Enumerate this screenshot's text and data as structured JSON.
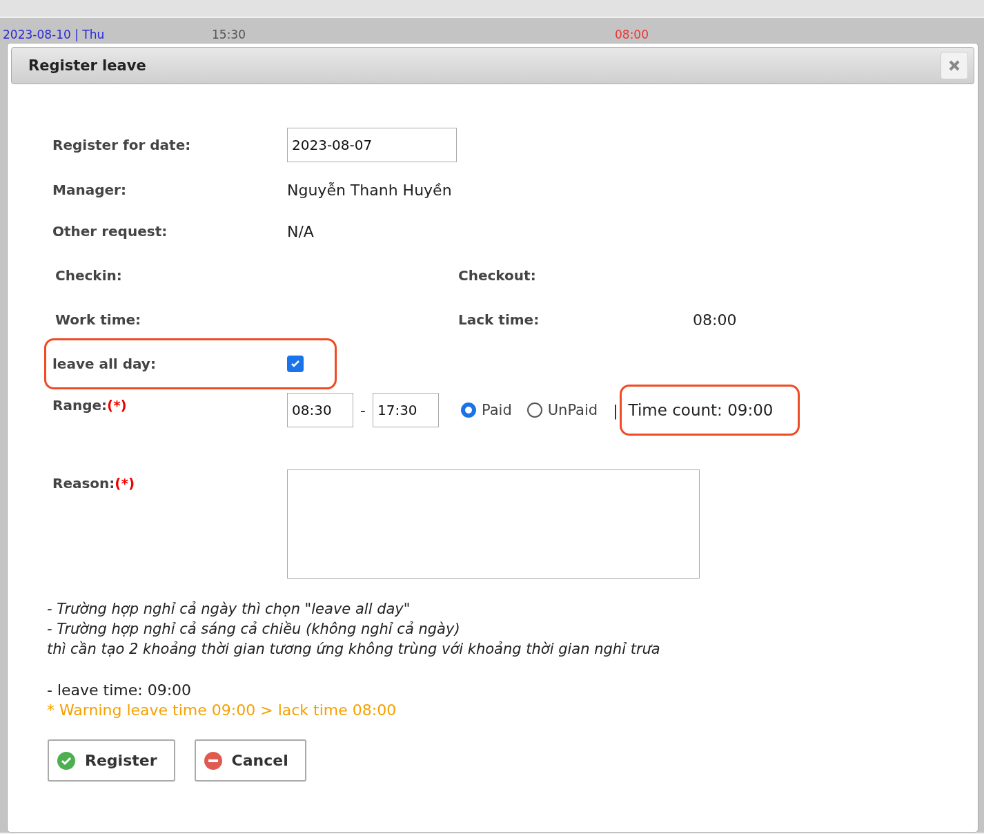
{
  "background_row": {
    "date": "2023-08-10 | Thu",
    "time": "15:30",
    "lack": "08:00"
  },
  "dialog": {
    "title": "Register leave"
  },
  "fields": [
    {
      "label": "Register for date:",
      "value": "2023-08-07",
      "kind": "input"
    },
    {
      "label": "Manager:",
      "value": "Nguyễn Thanh Huyền",
      "kind": "text"
    },
    {
      "label": "Other request:",
      "value": "N/A",
      "kind": "text"
    }
  ],
  "checkin": {
    "label": "Checkin:"
  },
  "checkout": {
    "label": "Checkout:"
  },
  "work_time": {
    "label": "Work time:"
  },
  "lack_time": {
    "label": "Lack time:",
    "value": "08:00"
  },
  "leave_all_day": {
    "label": "leave all day:",
    "checked": true
  },
  "range": {
    "label": "Range:",
    "required_mark": "(*)",
    "from": "08:30",
    "separator": "-",
    "to": "17:30"
  },
  "pay_options": [
    {
      "label": "Paid",
      "selected": true
    },
    {
      "label": "UnPaid",
      "selected": false
    }
  ],
  "divider": "|",
  "time_count": "Time count: 09:00",
  "reason": {
    "label": "Reason:",
    "required_mark": "(*)"
  },
  "notes": [
    "- Trường hợp nghỉ cả ngày thì chọn \"leave all day\"",
    "- Trường hợp nghỉ cả sáng cả chiều (không nghỉ cả ngày)",
    "thì cần tạo 2 khoảng thời gian tương ứng không trùng với khoảng thời gian nghỉ trưa"
  ],
  "leave_time": "- leave time: 09:00",
  "warning": "* Warning leave time 09:00 > lack time 08:00",
  "buttons": [
    {
      "label": "Register",
      "kind": "confirm"
    },
    {
      "label": "Cancel",
      "kind": "cancel"
    }
  ]
}
